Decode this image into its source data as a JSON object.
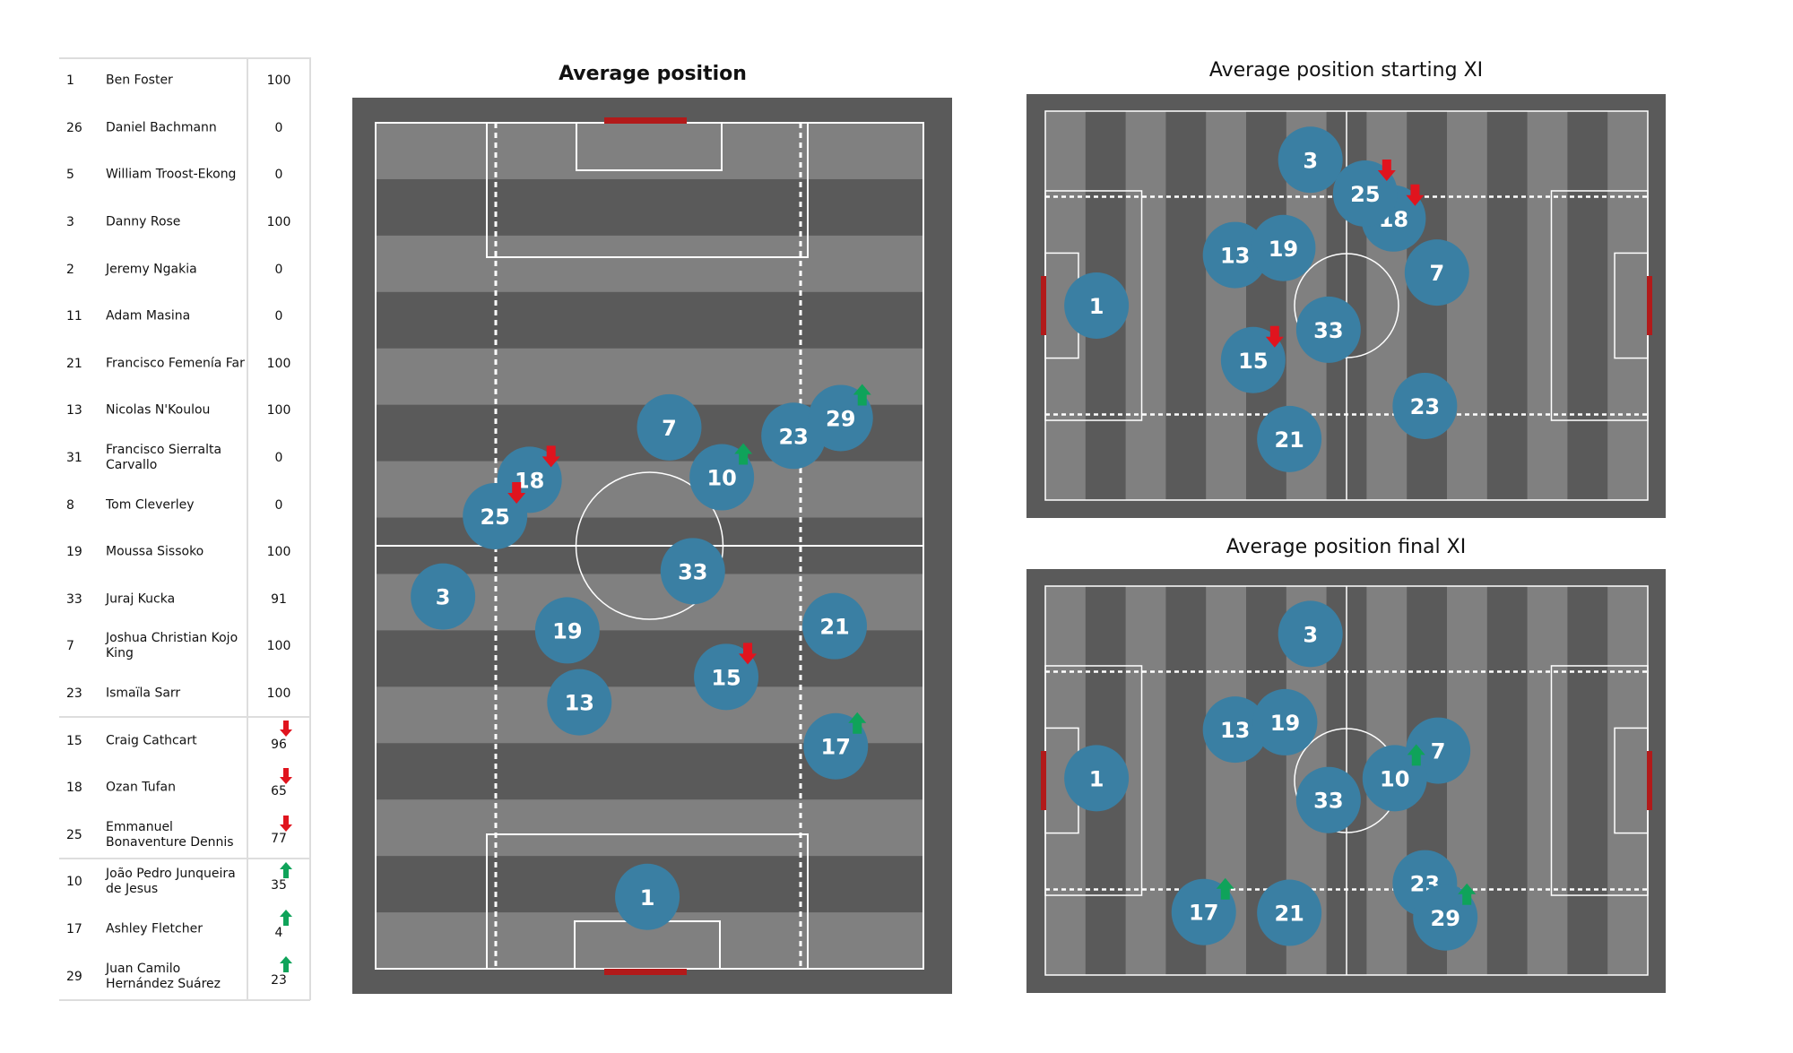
{
  "table": {
    "rows": [
      {
        "num": "1",
        "name": "Ben Foster",
        "value": "100",
        "change": null
      },
      {
        "num": "26",
        "name": "Daniel Bachmann",
        "value": "0",
        "change": null
      },
      {
        "num": "5",
        "name": "William Troost-Ekong",
        "value": "0",
        "change": null
      },
      {
        "num": "3",
        "name": "Danny Rose",
        "value": "100",
        "change": null
      },
      {
        "num": "2",
        "name": "Jeremy Ngakia",
        "value": "0",
        "change": null
      },
      {
        "num": "11",
        "name": "Adam Masina",
        "value": "0",
        "change": null
      },
      {
        "num": "21",
        "name": "Francisco Femenía Far",
        "value": "100",
        "change": null
      },
      {
        "num": "13",
        "name": "Nicolas N'Koulou",
        "value": "100",
        "change": null
      },
      {
        "num": "31",
        "name": "Francisco Sierralta Carvallo",
        "value": "0",
        "change": null
      },
      {
        "num": "8",
        "name": "Tom Cleverley",
        "value": "0",
        "change": null
      },
      {
        "num": "19",
        "name": "Moussa Sissoko",
        "value": "100",
        "change": null
      },
      {
        "num": "33",
        "name": "Juraj Kucka",
        "value": "91",
        "change": null
      },
      {
        "num": "7",
        "name": "Joshua Christian Kojo King",
        "value": "100",
        "change": null
      },
      {
        "num": "23",
        "name": "Ismaïla Sarr",
        "value": "100",
        "change": null
      },
      {
        "num": "15",
        "name": "Craig Cathcart",
        "value": "96",
        "change": "out"
      },
      {
        "num": "18",
        "name": "Ozan Tufan",
        "value": "65",
        "change": "out"
      },
      {
        "num": "25",
        "name": "Emmanuel Bonaventure Dennis",
        "value": "77",
        "change": "out"
      },
      {
        "num": "10",
        "name": "João Pedro Junqueira de Jesus",
        "value": "35",
        "change": "in"
      },
      {
        "num": "17",
        "name": "Ashley Fletcher",
        "value": "4",
        "change": "in"
      },
      {
        "num": "29",
        "name": "Juan Camilo Hernández Suárez",
        "value": "23",
        "change": "in"
      }
    ]
  },
  "colors": {
    "marker": "#3a7fa3",
    "sub_out": "#e0141e",
    "sub_in": "#0fa35a",
    "goal": "#b21a1a",
    "stripe_light": "#808080",
    "stripe_dark": "#5a5a5a",
    "frame": "#5a5a5a"
  },
  "chart_data": [
    {
      "type": "scatter",
      "title": "Average position",
      "orientation": "vertical",
      "note": "x: 0-100 across pitch width (left to right), y: 0-100 along pitch length (0 = own goal at bottom)",
      "points": [
        {
          "label": "1",
          "x": 49.6,
          "y": 8.5,
          "change": null
        },
        {
          "label": "3",
          "x": 12.3,
          "y": 44.0,
          "change": null
        },
        {
          "label": "7",
          "x": 53.6,
          "y": 64.0,
          "change": null
        },
        {
          "label": "10",
          "x": 63.2,
          "y": 58.1,
          "change": "in"
        },
        {
          "label": "13",
          "x": 37.2,
          "y": 31.5,
          "change": null
        },
        {
          "label": "15",
          "x": 64.0,
          "y": 34.5,
          "change": "out"
        },
        {
          "label": "17",
          "x": 84.0,
          "y": 26.3,
          "change": "in"
        },
        {
          "label": "18",
          "x": 28.1,
          "y": 57.8,
          "change": "out"
        },
        {
          "label": "19",
          "x": 35.0,
          "y": 40.0,
          "change": null
        },
        {
          "label": "21",
          "x": 83.8,
          "y": 40.5,
          "change": null
        },
        {
          "label": "23",
          "x": 76.3,
          "y": 63.0,
          "change": null
        },
        {
          "label": "25",
          "x": 21.8,
          "y": 53.5,
          "change": "out"
        },
        {
          "label": "29",
          "x": 84.9,
          "y": 65.1,
          "change": "in"
        },
        {
          "label": "33",
          "x": 57.9,
          "y": 47.0,
          "change": null
        }
      ]
    },
    {
      "type": "scatter",
      "title": "Average position starting XI",
      "orientation": "horizontal",
      "note": "x: 0-100 along pitch length (0 = own goal at left), y: 0-100 across pitch width (0 = top)",
      "points": [
        {
          "label": "1",
          "x": 8.5,
          "y": 50.0,
          "change": null
        },
        {
          "label": "3",
          "x": 44.0,
          "y": 12.5,
          "change": "none"
        },
        {
          "label": "7",
          "x": 65.0,
          "y": 41.5,
          "change": null
        },
        {
          "label": "13",
          "x": 31.5,
          "y": 37.0,
          "change": null
        },
        {
          "label": "15",
          "x": 34.5,
          "y": 64.0,
          "change": "out"
        },
        {
          "label": "18",
          "x": 57.8,
          "y": 27.6,
          "change": "out"
        },
        {
          "label": "19",
          "x": 39.5,
          "y": 35.2,
          "change": null
        },
        {
          "label": "21",
          "x": 40.5,
          "y": 84.3,
          "change": null
        },
        {
          "label": "23",
          "x": 63.0,
          "y": 75.8,
          "change": null
        },
        {
          "label": "25",
          "x": 53.1,
          "y": 21.2,
          "change": "out"
        },
        {
          "label": "33",
          "x": 47.0,
          "y": 56.2,
          "change": null
        }
      ]
    },
    {
      "type": "scatter",
      "title": "Average position final XI",
      "orientation": "horizontal",
      "note": "x: 0-100 along pitch length (0 = own goal at left), y: 0-100 across pitch width (0 = top)",
      "points": [
        {
          "label": "1",
          "x": 8.5,
          "y": 49.4,
          "change": null
        },
        {
          "label": "3",
          "x": 44.0,
          "y": 12.3,
          "change": null
        },
        {
          "label": "7",
          "x": 65.2,
          "y": 42.3,
          "change": null
        },
        {
          "label": "10",
          "x": 58.0,
          "y": 49.4,
          "change": "in"
        },
        {
          "label": "13",
          "x": 31.5,
          "y": 36.9,
          "change": null
        },
        {
          "label": "17",
          "x": 26.3,
          "y": 83.8,
          "change": "in"
        },
        {
          "label": "19",
          "x": 39.8,
          "y": 35.0,
          "change": null
        },
        {
          "label": "21",
          "x": 40.5,
          "y": 84.0,
          "change": null
        },
        {
          "label": "23",
          "x": 63.0,
          "y": 76.4,
          "change": null
        },
        {
          "label": "29",
          "x": 66.4,
          "y": 85.2,
          "change": "in"
        },
        {
          "label": "33",
          "x": 47.0,
          "y": 55.0,
          "change": null
        }
      ]
    }
  ]
}
